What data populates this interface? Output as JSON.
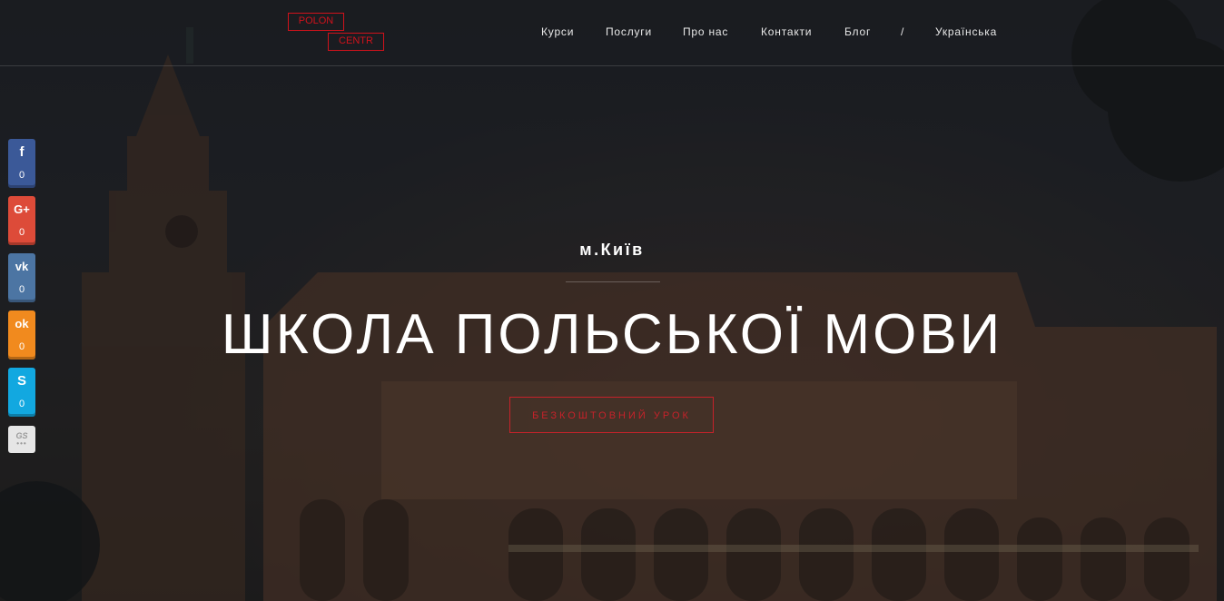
{
  "logo": {
    "line1": "POLON",
    "line2": "CENTR"
  },
  "nav": {
    "items": [
      {
        "label": "Курси"
      },
      {
        "label": "Послуги"
      },
      {
        "label": "Про нас"
      },
      {
        "label": "Контакти"
      },
      {
        "label": "Блог"
      },
      {
        "label": "/"
      },
      {
        "label": "Українська"
      }
    ]
  },
  "social": {
    "items": [
      {
        "network": "facebook",
        "icon": "facebook-icon",
        "glyph": "f",
        "count": "0",
        "color": "#3b5998"
      },
      {
        "network": "google-plus",
        "icon": "google-plus-icon",
        "glyph": "G+",
        "count": "0",
        "color": "#dd4b39"
      },
      {
        "network": "vkontakte",
        "icon": "vk-icon",
        "glyph": "vk",
        "count": "0",
        "color": "#4c75a3"
      },
      {
        "network": "odnoklassniki",
        "icon": "odnoklassniki-icon",
        "glyph": "ok",
        "count": "0",
        "color": "#f18a1e"
      },
      {
        "network": "skype",
        "icon": "skype-icon",
        "glyph": "S",
        "count": "0",
        "color": "#12a8e0"
      }
    ],
    "gs_label": "GS",
    "gs_dots": "•••"
  },
  "hero": {
    "city": "м.Київ",
    "title": "ШКОЛА ПОЛЬСЬКОЇ МОВИ",
    "cta": "БЕЗКОШТОВНИЙ УРОК"
  },
  "colors": {
    "accent": "#c6222a",
    "logo": "#d0121b",
    "text": "#ffffff"
  }
}
